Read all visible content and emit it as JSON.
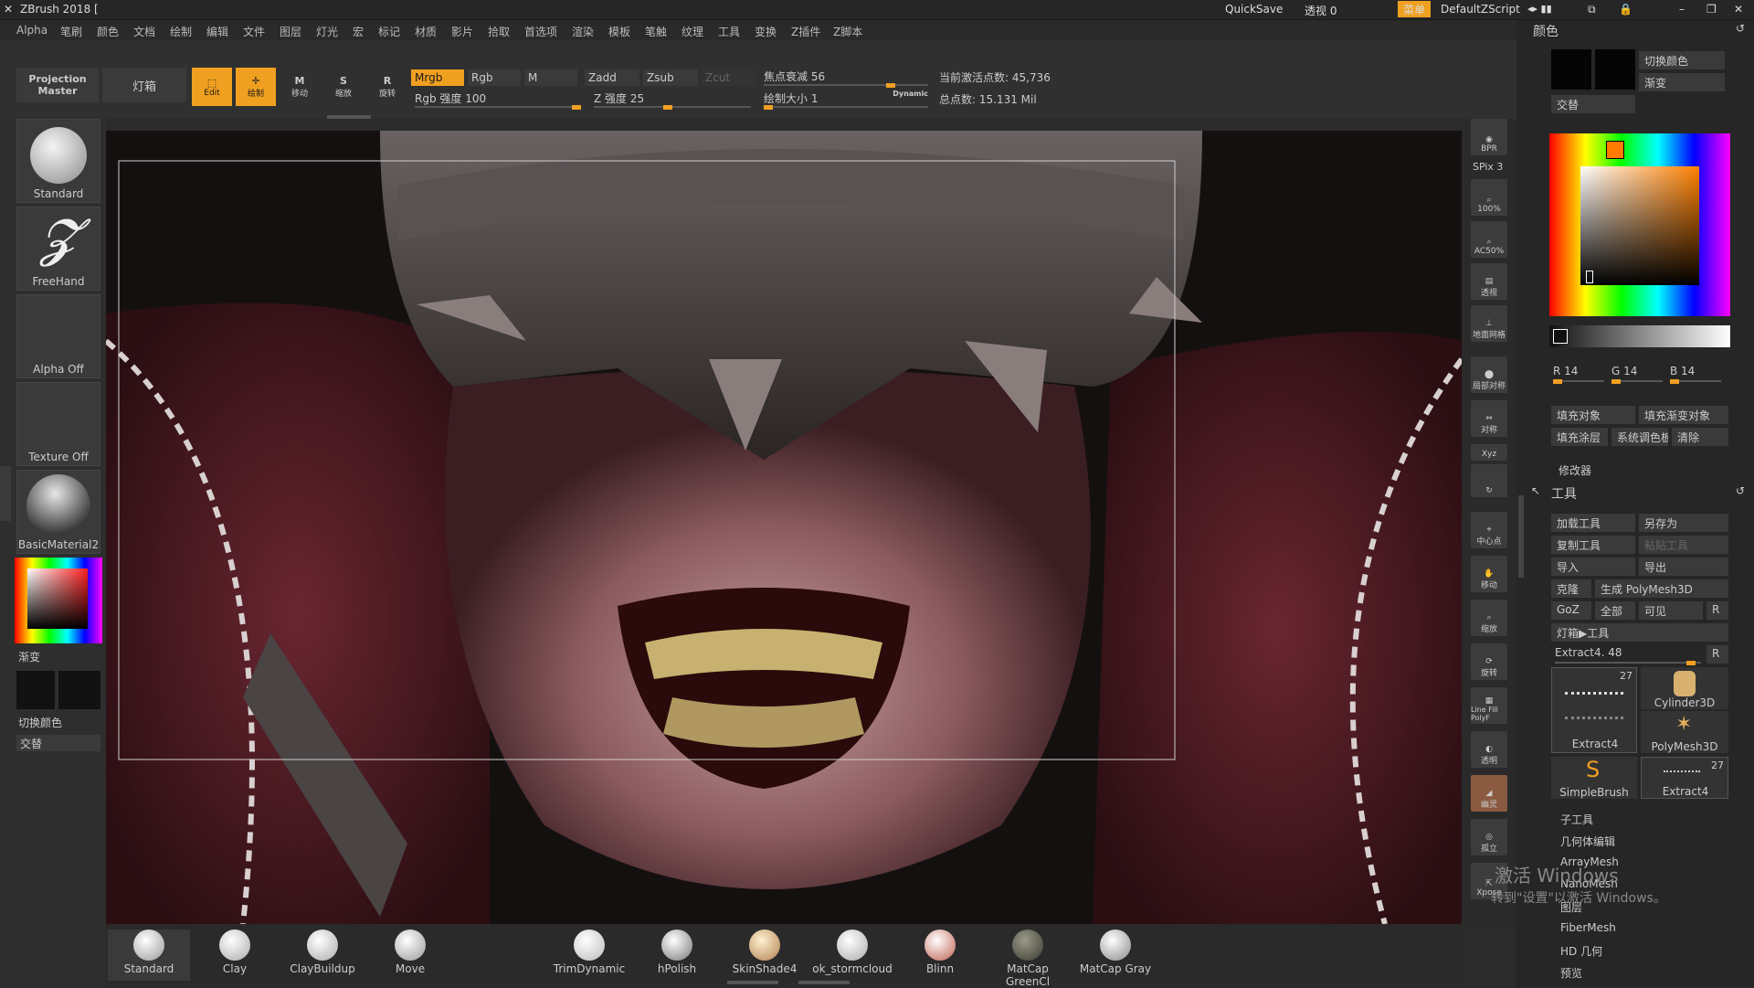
{
  "title": {
    "app": "ZBrush 2018 [",
    "quicksave": "QuickSave",
    "transparency": "透视  0",
    "menu": "菜单",
    "script": "DefaultZScript"
  },
  "menus": [
    "Alpha",
    "笔刷",
    "颜色",
    "文档",
    "绘制",
    "编辑",
    "文件",
    "图层",
    "灯光",
    "宏",
    "标记",
    "材质",
    "影片",
    "拾取",
    "首选项",
    "渲染",
    "模板",
    "笔触",
    "纹理",
    "工具",
    "变换",
    "Z插件",
    "Z脚本"
  ],
  "toolbar": {
    "projection_master": "Projection Master",
    "lightbox": "灯箱",
    "edit": "Edit",
    "draw": "绘制",
    "move": "移动",
    "scale": "缩放",
    "rotate": "旋转",
    "mrgb": "Mrgb",
    "rgb": "Rgb",
    "m": "M",
    "zadd": "Zadd",
    "zsub": "Zsub",
    "zcut": "Zcut",
    "rgb_intensity": "Rgb 强度 100",
    "z_intensity": "Z 强度 25",
    "focal_shift": "焦点衰减 56",
    "draw_size": "绘制大小 1",
    "dynamic": "Dynamic",
    "active_points": "当前激活点数: 45,736",
    "total_points": "总点数: 15.131 Mil"
  },
  "left": {
    "brush": "Standard",
    "stroke": "FreeHand",
    "alpha": "Alpha Off",
    "texture": "Texture Off",
    "material": "BasicMaterial2",
    "gradient": "渐变",
    "switch_color": "切换颜色",
    "alternate": "交替"
  },
  "right_shelf": [
    "BPR",
    "SPix 3",
    "100%",
    "AC50%",
    "透视",
    "地面网格",
    "局部对称",
    "对称",
    "Xyz",
    "",
    "中心点",
    "移动",
    "缩放",
    "旋转",
    "Line Fill PolyF",
    "透明",
    "幽灵",
    "孤立",
    "Xpose"
  ],
  "panel": {
    "color_title": "颜色",
    "switch_color": "切换颜色",
    "gradient": "渐变",
    "alternate": "交替",
    "r": "R 14",
    "g": "G 14",
    "b": "B 14",
    "fill_object": "填充对象",
    "fill_gradient": "填充渐变对象",
    "fill_layer": "填充涂层",
    "sys_palette": "系统调色板",
    "clear": "清除",
    "modifiers": "修改器",
    "tool_title": "工具",
    "load_tool": "加载工具",
    "save_as": "另存为",
    "copy_tool": "复制工具",
    "paste_tool": "粘贴工具",
    "import": "导入",
    "export": "导出",
    "clone": "克隆",
    "make_polymesh": "生成 PolyMesh3D",
    "goz": "GoZ",
    "all": "全部",
    "visible": "可见",
    "r_btn": "R",
    "lightbox_tool": "灯箱▶工具",
    "current_tool": "Extract4. 48",
    "tools": [
      {
        "name": "Extract4",
        "count": "27"
      },
      {
        "name": "Cylinder3D",
        "count": ""
      },
      {
        "name": "PolyMesh3D",
        "count": ""
      },
      {
        "name": "SimpleBrush",
        "count": ""
      },
      {
        "name": "Extract4",
        "count": "27"
      }
    ],
    "subtools": [
      "子工具",
      "几何体编辑",
      "ArrayMesh",
      "NanoMesh",
      "图层",
      "FiberMesh",
      "HD 几何",
      "预览"
    ],
    "watermark1": "激活 Windows",
    "watermark2": "转到\"设置\"以激活 Windows。"
  },
  "materials": [
    {
      "name": "Standard",
      "color": "#d8d8d8"
    },
    {
      "name": "Clay",
      "color": "#cfcfcf"
    },
    {
      "name": "ClayBuildup",
      "color": "#dcdcdc"
    },
    {
      "name": "Move",
      "color": "#c8c8c8"
    },
    {
      "name": "TrimDynamic",
      "color": "#e0e0e0"
    },
    {
      "name": "hPolish",
      "color": "#bcbcbc"
    },
    {
      "name": "SkinShade4",
      "color": "#d9b98a"
    },
    {
      "name": "ok_stormcloud",
      "color": "#d0d0d0"
    },
    {
      "name": "Blinn",
      "color": "#e8c8c0"
    },
    {
      "name": "MatCap GreenCl",
      "color": "#6a6a5a"
    },
    {
      "name": "MatCap Gray",
      "color": "#b8b8b8"
    }
  ],
  "colors": {
    "accent": "#f0a020",
    "bg": "#2b2b2b",
    "viewport": "#1a1111"
  }
}
